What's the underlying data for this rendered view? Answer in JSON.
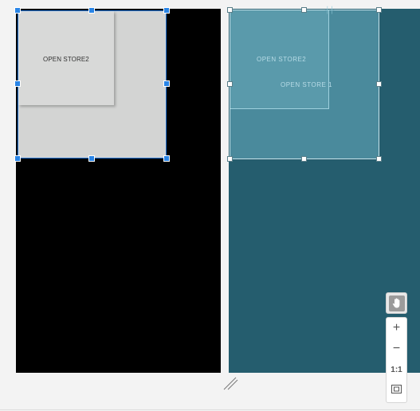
{
  "design_surface": {
    "outer_component_label": "OPEN STORE2"
  },
  "blueprint_surface": {
    "outer_component_label": "OPEN STORE2",
    "inner_component_label": "OPEN STORE 1"
  },
  "zoom_controls": {
    "pan_icon": "hand-icon",
    "zoom_in_label": "+",
    "zoom_out_label": "−",
    "actual_size_label": "1:1",
    "fit_screen_icon": "fit-screen-icon"
  },
  "colors": {
    "design_background": "#000000",
    "blueprint_background": "#255d6e",
    "selection_accent": "#2a85e6"
  }
}
